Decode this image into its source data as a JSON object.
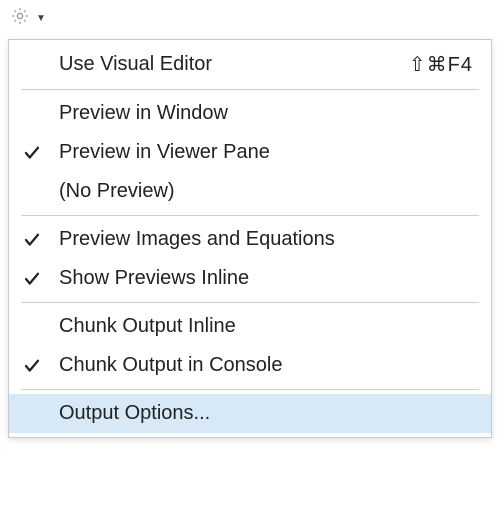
{
  "menu": {
    "items": [
      {
        "label": "Use Visual Editor",
        "checked": false,
        "shortcut": "⇧⌘F4"
      },
      {
        "label": "Preview in Window",
        "checked": false
      },
      {
        "label": "Preview in Viewer Pane",
        "checked": true
      },
      {
        "label": "(No Preview)",
        "checked": false
      },
      {
        "label": "Preview Images and Equations",
        "checked": true
      },
      {
        "label": "Show Previews Inline",
        "checked": true
      },
      {
        "label": "Chunk Output Inline",
        "checked": false
      },
      {
        "label": "Chunk Output in Console",
        "checked": true
      },
      {
        "label": "Output Options...",
        "checked": false,
        "highlight": true
      }
    ]
  }
}
